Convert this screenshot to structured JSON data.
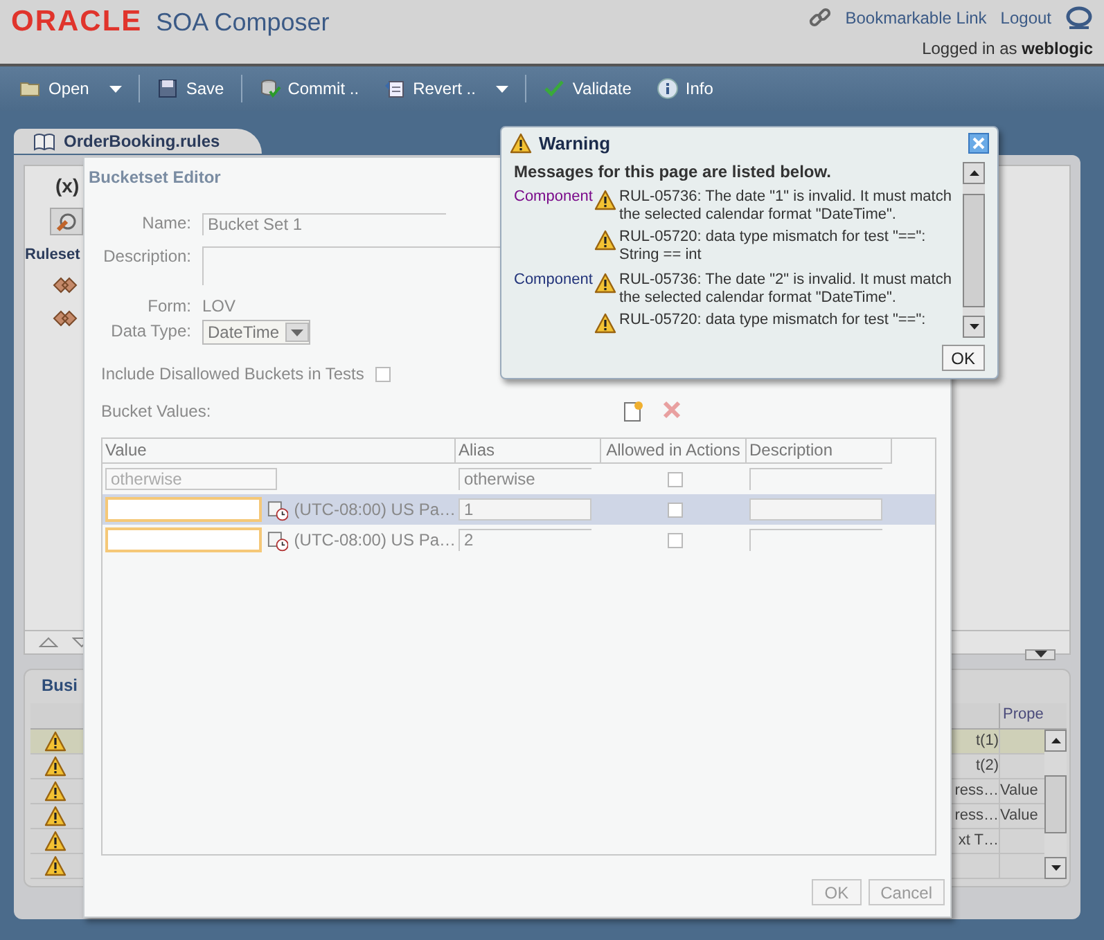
{
  "header": {
    "logo": "ORACLE",
    "product": "SOA Composer",
    "links": [
      "Bookmarkable Link",
      "Logout"
    ],
    "logged_in_label": "Logged in as",
    "user": "weblogic"
  },
  "toolbar": {
    "groups": [
      [
        {
          "label": "Open",
          "kind": "menu"
        }
      ],
      [
        {
          "label": "Save",
          "kind": "button"
        }
      ],
      [
        {
          "label": "Commit ..",
          "kind": "button"
        },
        {
          "label": "Revert ..",
          "kind": "menu"
        }
      ],
      [
        {
          "label": "Validate",
          "kind": "button"
        },
        {
          "label": "Info",
          "kind": "button"
        }
      ]
    ]
  },
  "tab": {
    "label": "OrderBooking.rules",
    "selected": true
  },
  "rules_panel": {
    "variables_label": "(x)",
    "ruleset_heading": "Ruleset"
  },
  "business_panel": {
    "heading": "Busi",
    "last_column_header": "Prope",
    "rows": [
      {
        "selected": true,
        "column_a": "t(1)"
      },
      {
        "selected": false,
        "column_a": "t(2)"
      },
      {
        "selected": false,
        "column_a": "ress…",
        "column_b": "Value"
      },
      {
        "selected": false,
        "column_a": "ress…",
        "column_b": "Value"
      },
      {
        "selected": false,
        "column_a": "xt T…"
      },
      {
        "selected": false
      }
    ]
  },
  "bucketset_editor": {
    "title": "Bucketset Editor",
    "name": {
      "label": "Name:",
      "value": "Bucket Set 1"
    },
    "description": {
      "label": "Description:"
    },
    "form": {
      "label": "Form:",
      "value": "LOV"
    },
    "data_type": {
      "label": "Data Type:",
      "value": "DateTime"
    },
    "include_disallowed": {
      "label": "Include Disallowed Buckets in Tests",
      "checked": false
    },
    "bucket_values_label": "Bucket Values:",
    "columns": [
      "Value",
      "Alias",
      "Allowed in Actions",
      "Description"
    ],
    "rows": [
      {
        "kind": "fixed",
        "value": "otherwise",
        "alias": "otherwise",
        "allowed": false,
        "selected": false,
        "invalid": false
      },
      {
        "kind": "date",
        "timezone": "(UTC-08:00) US Pa…",
        "alias": "1",
        "allowed": false,
        "selected": true,
        "invalid": true
      },
      {
        "kind": "date",
        "timezone": "(UTC-08:00) US Pa…",
        "alias": "2",
        "allowed": false,
        "selected": false,
        "invalid": true
      }
    ],
    "buttons": [
      "OK",
      "Cancel"
    ]
  },
  "warning_dialog": {
    "title": "Warning",
    "heading": "Messages for this page are listed below.",
    "groups": [
      {
        "component": "Component",
        "visited": true,
        "messages": [
          "RUL-05736: The date \"1\" is invalid. It must match the selected calendar format \"DateTime\".",
          "RUL-05720: data type mismatch for test \"==\": String == int"
        ]
      },
      {
        "component": "Component",
        "visited": false,
        "messages": [
          "RUL-05736: The date \"2\" is invalid. It must match the selected calendar format \"DateTime\".",
          "RUL-05720: data type mismatch for test \"==\":"
        ]
      }
    ],
    "button": "OK"
  }
}
